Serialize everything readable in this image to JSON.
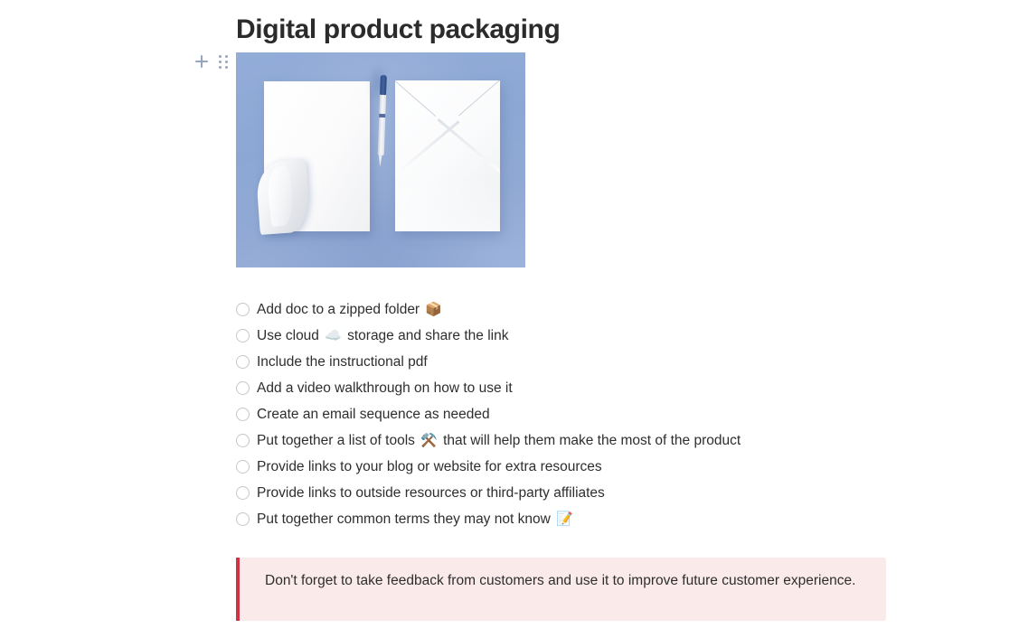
{
  "document": {
    "title": "Digital product packaging"
  },
  "block_controls": {
    "add_label": "+",
    "add_icon": "plus-icon",
    "drag_icon": "drag-handle-icon"
  },
  "hero_image": {
    "alt": "White paper sheet with curled corner, a blue pen, and a white envelope on a periwinkle blue background",
    "background_color": "#8fa8d4",
    "paper_color": "#ffffff",
    "shadow_color": "#5d74ad",
    "pen_accent_color": "#2c4a83"
  },
  "checklist": {
    "items": [
      {
        "label": "Add doc to a zipped folder",
        "emoji": "📦",
        "emoji_name": "package-emoji",
        "checked": false
      },
      {
        "label": "Use cloud",
        "emoji": "☁️",
        "emoji_name": "cloud-emoji",
        "suffix": "storage and share the link",
        "checked": false
      },
      {
        "label": "Include the instructional pdf",
        "emoji": "",
        "emoji_name": "",
        "checked": false
      },
      {
        "label": "Add a video walkthrough on how to use it",
        "emoji": "",
        "emoji_name": "",
        "checked": false
      },
      {
        "label": "Create an email sequence as needed",
        "emoji": "",
        "emoji_name": "",
        "checked": false
      },
      {
        "label": "Put together a list of tools",
        "emoji": "⚒️",
        "emoji_name": "hammer-and-pick-emoji",
        "suffix": "that will help them make the most of the product",
        "checked": false
      },
      {
        "label": "Provide links to your blog or website for extra resources",
        "emoji": "",
        "emoji_name": "",
        "checked": false
      },
      {
        "label": "Provide links to outside resources or third-party affiliates",
        "emoji": "",
        "emoji_name": "",
        "checked": false
      },
      {
        "label": "Put together common terms they may not know",
        "emoji": "📝",
        "emoji_name": "memo-emoji",
        "checked": false
      }
    ]
  },
  "callout": {
    "text": "Don't forget to take feedback from customers and use it to improve future customer experience.",
    "accent_color": "#cc3344",
    "background_color": "#fbeaea"
  }
}
